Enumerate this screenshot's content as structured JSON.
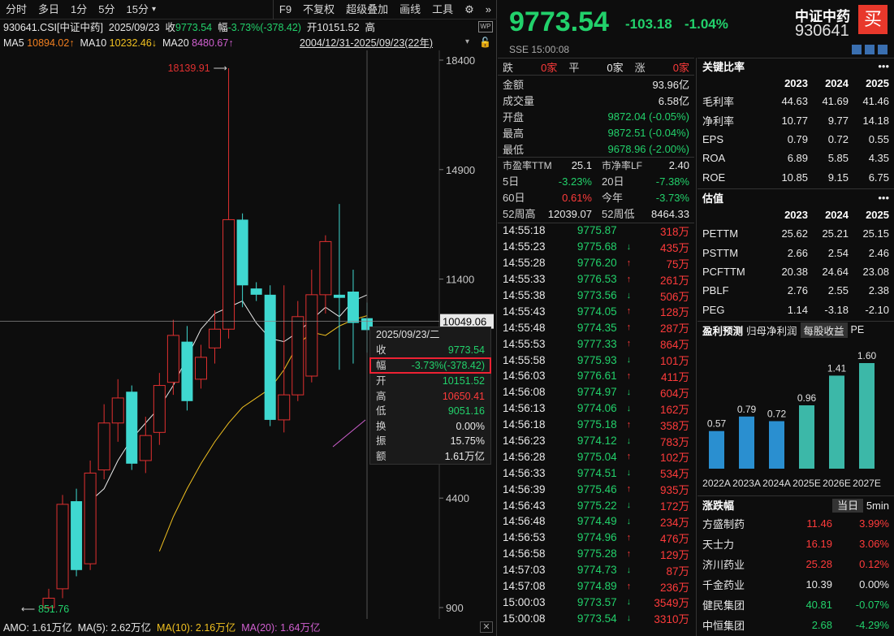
{
  "toolbar": {
    "items": [
      "分时",
      "多日",
      "1分",
      "5分",
      "15分",
      "▾"
    ],
    "right_items": [
      "F9",
      "不复权",
      "超级叠加",
      "画线",
      "工具"
    ]
  },
  "info": {
    "code": "930641.CSI[中证中药]",
    "date": "2025/09/23",
    "close_label": "收",
    "close": "9773.54",
    "chg_label": "幅",
    "chg": "-3.73%(-378.42)",
    "open_label": "开",
    "open": "10151.52",
    "high_label": "高"
  },
  "ma": {
    "ma5_label": "MA5",
    "ma5": "10894.02↑",
    "ma10_label": "MA10",
    "ma10": "10232.46↓",
    "ma20_label": "MA20",
    "ma20": "8480.67↑",
    "range": "2004/12/31-2025/09/23(22年)",
    "colors": {
      "ma5": "#e8e8e8",
      "ma10": "#f0c020",
      "ma20": "#d060d0"
    }
  },
  "chart_data": {
    "type": "candlestick",
    "ylim": [
      900,
      18400
    ],
    "y_ticks": [
      "18400",
      "14900",
      "11400",
      "4400",
      "900"
    ],
    "max_label": "18139.91",
    "min_label": "851.76",
    "crosshair_value": "10049.06",
    "candles": [
      {
        "o": 900,
        "c": 1200,
        "h": 1500,
        "l": 850
      },
      {
        "o": 1500,
        "c": 4200,
        "h": 4500,
        "l": 1200
      },
      {
        "o": 4300,
        "c": 2100,
        "h": 4700,
        "l": 1900
      },
      {
        "o": 2300,
        "c": 5200,
        "h": 5600,
        "l": 2100
      },
      {
        "o": 5300,
        "c": 6800,
        "h": 7400,
        "l": 5000
      },
      {
        "o": 6800,
        "c": 7600,
        "h": 8200,
        "l": 6200
      },
      {
        "o": 7800,
        "c": 5500,
        "h": 8000,
        "l": 5300
      },
      {
        "o": 5600,
        "c": 6400,
        "h": 7000,
        "l": 5200
      },
      {
        "o": 6500,
        "c": 8000,
        "h": 8400,
        "l": 6100
      },
      {
        "o": 8100,
        "c": 9600,
        "h": 10100,
        "l": 7700
      },
      {
        "o": 9400,
        "c": 7500,
        "h": 9900,
        "l": 7200
      },
      {
        "o": 8200,
        "c": 8900,
        "h": 9300,
        "l": 7900
      },
      {
        "o": 9200,
        "c": 9800,
        "h": 10400,
        "l": 8700
      },
      {
        "o": 9800,
        "c": 13300,
        "h": 18140,
        "l": 9500
      },
      {
        "o": 13300,
        "c": 11200,
        "h": 13500,
        "l": 10500
      },
      {
        "o": 11100,
        "c": 10900,
        "h": 11300,
        "l": 10700
      },
      {
        "o": 10900,
        "c": 6900,
        "h": 11200,
        "l": 6700
      },
      {
        "o": 6900,
        "c": 7700,
        "h": 11200,
        "l": 6500
      },
      {
        "o": 7700,
        "c": 10200,
        "h": 10700,
        "l": 7500
      },
      {
        "o": 8300,
        "c": 10900,
        "h": 11700,
        "l": 8100
      },
      {
        "o": 10900,
        "c": 12600,
        "h": 12800,
        "l": 10300
      },
      {
        "o": 10900,
        "c": 10800,
        "h": 13800,
        "l": 8500
      },
      {
        "o": 11000,
        "c": 10000,
        "h": 11700,
        "l": 8700
      },
      {
        "o": 10150,
        "c": 9770,
        "h": 10650,
        "l": 9050
      }
    ],
    "ma_lines": {
      "ma5": [
        4300,
        4700,
        5600,
        6300,
        6800,
        7300,
        8000,
        8900,
        9800,
        10300,
        10500,
        10700,
        10000,
        9500,
        9400,
        9700,
        10100,
        10500,
        10200,
        10700,
        10894
      ],
      "ma10": [
        2700,
        3800,
        4700,
        5500,
        6200,
        6800,
        7300,
        7600,
        7900,
        8500,
        9300,
        9700,
        9600,
        9900,
        10100,
        10232
      ]
    }
  },
  "tooltip": {
    "date": "2025/09/23/二",
    "rows": [
      [
        "收",
        "9773.54"
      ],
      [
        "幅",
        "-3.73%(-378.42)"
      ],
      [
        "开",
        "10151.52"
      ],
      [
        "高",
        "10650.41"
      ],
      [
        "低",
        "9051.16"
      ],
      [
        "换",
        "0.00%"
      ],
      [
        "振",
        "15.75%"
      ],
      [
        "额",
        "1.61万亿"
      ]
    ]
  },
  "amo": {
    "label": "AMO: 1.61万亿",
    "ma5": "MA(5): 2.62万亿",
    "ma10": "MA(10): 2.16万亿",
    "ma20": "MA(20): 1.64万亿"
  },
  "quote": {
    "price": "9773.54",
    "change": "-103.18",
    "pct": "-1.04%",
    "name": "中证中药",
    "code": "930641",
    "buy": "买",
    "exchange": "SSE",
    "time": "15:00:08"
  },
  "stats": {
    "die": "跌",
    "die_v": "0家",
    "ping": "平",
    "ping_v": "0家",
    "zhang": "涨",
    "zhang_v": "0家",
    "rows": [
      [
        "金额",
        "93.96亿"
      ],
      [
        "成交量",
        "6.58亿"
      ],
      [
        "开盘",
        "9872.04 (-0.05%)"
      ],
      [
        "最高",
        "9872.51 (-0.04%)"
      ],
      [
        "最低",
        "9678.96 (-2.00%)"
      ]
    ],
    "pe_l": "市盈率TTM",
    "pe": "25.1",
    "pb_l": "市净率LF",
    "pb": "2.40",
    "d5_l": "5日",
    "d5": "-3.23%",
    "d20_l": "20日",
    "d20": "-7.38%",
    "d60_l": "60日",
    "d60": "0.61%",
    "yr_l": "今年",
    "yr": "-3.73%",
    "h52_l": "52周高",
    "h52": "12039.07",
    "l52_l": "52周低",
    "l52": "8464.33"
  },
  "ticks": [
    [
      "14:55:18",
      "9775.87",
      "",
      "318万"
    ],
    [
      "14:55:23",
      "9775.68",
      "↓",
      "435万"
    ],
    [
      "14:55:28",
      "9776.20",
      "↑",
      "75万"
    ],
    [
      "14:55:33",
      "9776.53",
      "↑",
      "261万"
    ],
    [
      "14:55:38",
      "9773.56",
      "↓",
      "506万"
    ],
    [
      "14:55:43",
      "9774.05",
      "↑",
      "128万"
    ],
    [
      "14:55:48",
      "9774.35",
      "↑",
      "287万"
    ],
    [
      "14:55:53",
      "9777.33",
      "↑",
      "864万"
    ],
    [
      "14:55:58",
      "9775.93",
      "↓",
      "101万"
    ],
    [
      "14:56:03",
      "9776.61",
      "↑",
      "411万"
    ],
    [
      "14:56:08",
      "9774.97",
      "↓",
      "604万"
    ],
    [
      "14:56:13",
      "9774.06",
      "↓",
      "162万"
    ],
    [
      "14:56:18",
      "9775.18",
      "↑",
      "358万"
    ],
    [
      "14:56:23",
      "9774.12",
      "↓",
      "783万"
    ],
    [
      "14:56:28",
      "9775.04",
      "↑",
      "102万"
    ],
    [
      "14:56:33",
      "9774.51",
      "↓",
      "534万"
    ],
    [
      "14:56:39",
      "9775.46",
      "↑",
      "935万"
    ],
    [
      "14:56:43",
      "9775.22",
      "↓",
      "172万"
    ],
    [
      "14:56:48",
      "9774.49",
      "↓",
      "234万"
    ],
    [
      "14:56:53",
      "9774.96",
      "↑",
      "476万"
    ],
    [
      "14:56:58",
      "9775.28",
      "↑",
      "129万"
    ],
    [
      "14:57:03",
      "9774.73",
      "↓",
      "87万"
    ],
    [
      "14:57:08",
      "9774.89",
      "↑",
      "236万"
    ],
    [
      "15:00:03",
      "9773.57",
      "↓",
      "3549万"
    ],
    [
      "15:00:08",
      "9773.54",
      "↓",
      "3310万"
    ]
  ],
  "ratios": {
    "title": "关键比率",
    "years": [
      "2023",
      "2024",
      "2025"
    ],
    "rows": [
      [
        "毛利率",
        "44.63",
        "41.69",
        "41.46"
      ],
      [
        "净利率",
        "10.77",
        "9.77",
        "14.18"
      ],
      [
        "EPS",
        "0.79",
        "0.72",
        "0.55"
      ],
      [
        "ROA",
        "6.89",
        "5.85",
        "4.35"
      ],
      [
        "ROE",
        "10.85",
        "9.15",
        "6.75"
      ]
    ]
  },
  "valuation": {
    "title": "估值",
    "years": [
      "2023",
      "2024",
      "2025"
    ],
    "rows": [
      [
        "PETTM",
        "25.62",
        "25.21",
        "25.15"
      ],
      [
        "PSTTM",
        "2.66",
        "2.54",
        "2.46"
      ],
      [
        "PCFTTM",
        "20.38",
        "24.64",
        "23.08"
      ],
      [
        "PBLF",
        "2.76",
        "2.55",
        "2.38"
      ],
      [
        "PEG",
        "1.14",
        "-3.18",
        "-2.10"
      ]
    ]
  },
  "forecast": {
    "title": "盈利预测",
    "sub": "归母净利润",
    "tab": "每股收益",
    "pe": "PE",
    "labels": [
      "2022A",
      "2023A",
      "2024A",
      "2025E",
      "2026E",
      "2027E"
    ],
    "values": [
      0.57,
      0.79,
      0.72,
      0.96,
      1.41,
      1.6
    ],
    "value_labels": [
      "0.57",
      "0.79",
      "0.72",
      "0.96",
      "1.41",
      "1.60"
    ]
  },
  "movers": {
    "title": "涨跌幅",
    "tab1": "当日",
    "tab2": "5min",
    "rows": [
      [
        "方盛制药",
        "11.46",
        "3.99%",
        "r"
      ],
      [
        "天士力",
        "16.19",
        "3.06%",
        "r"
      ],
      [
        "济川药业",
        "25.28",
        "0.12%",
        "r"
      ],
      [
        "千金药业",
        "10.39",
        "0.00%",
        "w"
      ],
      [
        "健民集团",
        "40.81",
        "-0.07%",
        "g"
      ],
      [
        "中恒集团",
        "2.68",
        "-4.29%",
        "g"
      ]
    ]
  }
}
